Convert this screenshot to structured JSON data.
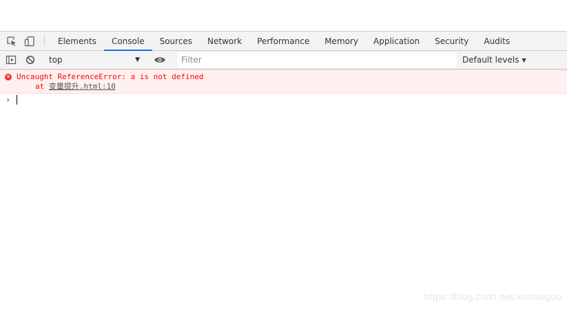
{
  "devtools": {
    "tabs": [
      {
        "label": "Elements"
      },
      {
        "label": "Console",
        "active": true
      },
      {
        "label": "Sources"
      },
      {
        "label": "Network"
      },
      {
        "label": "Performance"
      },
      {
        "label": "Memory"
      },
      {
        "label": "Application"
      },
      {
        "label": "Security"
      },
      {
        "label": "Audits"
      }
    ],
    "icons": {
      "inspect": "inspect-element-icon",
      "device": "device-toolbar-icon",
      "sidebar": "show-sidebar-icon",
      "clear": "clear-console-icon",
      "eye": "live-expression-icon"
    },
    "accent_color": "#1a73e8"
  },
  "console_toolbar": {
    "context": "top",
    "filter_placeholder": "Filter",
    "levels": "Default levels"
  },
  "messages": [
    {
      "level": "error",
      "text": "Uncaught ReferenceError: a is not defined",
      "stack_prefix": "at ",
      "stack_link": "变量提升.html:10"
    }
  ],
  "prompt": {
    "symbol": "›"
  },
  "watermark": "https://blog.csdn.net/xishaoguo"
}
